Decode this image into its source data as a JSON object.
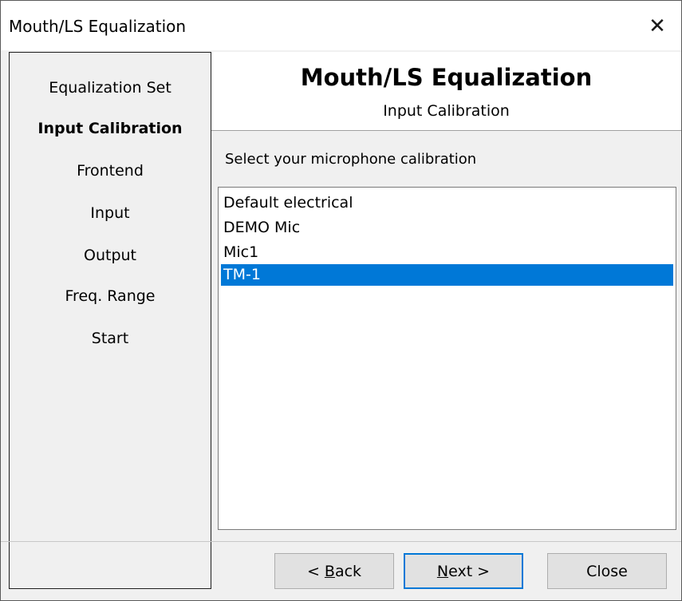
{
  "window": {
    "title": "Mouth/LS Equalization",
    "close_glyph": "✕"
  },
  "sidebar": {
    "steps": [
      {
        "label": "Equalization Set",
        "active": false
      },
      {
        "label": "Input Calibration",
        "active": true
      },
      {
        "label": "Frontend",
        "active": false
      },
      {
        "label": "Input",
        "active": false
      },
      {
        "label": "Output",
        "active": false
      },
      {
        "label": "Freq. Range",
        "active": false
      },
      {
        "label": "Start",
        "active": false
      }
    ]
  },
  "header": {
    "title": "Mouth/LS Equalization",
    "subtitle": "Input Calibration"
  },
  "main": {
    "prompt": "Select your microphone calibration",
    "calibrations": [
      {
        "label": "Default electrical",
        "selected": false
      },
      {
        "label": "DEMO Mic",
        "selected": false
      },
      {
        "label": "Mic1",
        "selected": false
      },
      {
        "label": "TM-1",
        "selected": true
      }
    ]
  },
  "buttons": {
    "back": {
      "prefix": "< ",
      "access_key": "B",
      "rest": "ack"
    },
    "next": {
      "access_key": "N",
      "rest": "ext >"
    },
    "close": {
      "label": "Close"
    }
  },
  "colors": {
    "selection": "#0078d7",
    "default_button_border": "#0078d7"
  }
}
